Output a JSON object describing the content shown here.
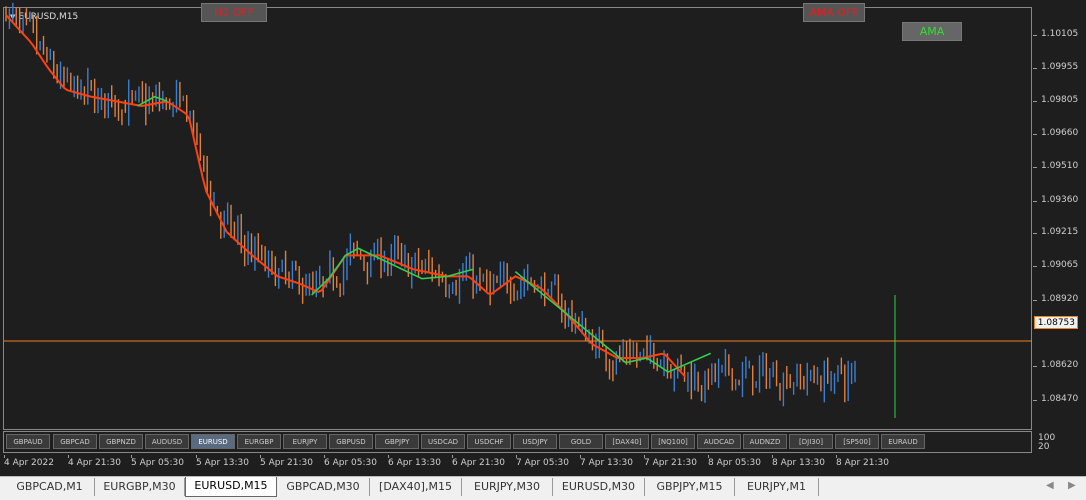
{
  "window": {
    "title": "EURUSD,M15"
  },
  "buttons": {
    "h1_off": "H1 OFF",
    "ama_off": "AMA OFF",
    "ama": "AMA"
  },
  "colors": {
    "bull": "#3a7fd0",
    "bear": "#e08040",
    "ma_red": "#ff4010",
    "ama_green": "#30d050",
    "price_line": "#f08020"
  },
  "price_axis": {
    "labels": [
      "1.10105",
      "1.09955",
      "1.09805",
      "1.09660",
      "1.09510",
      "1.09360",
      "1.09215",
      "1.09065",
      "1.08920",
      "1.08620",
      "1.08470"
    ],
    "last_price": "1.08753"
  },
  "subpanel": {
    "symbols": [
      "GBPAUD",
      "GBPCAD",
      "GBPNZD",
      "AUDUSD",
      "EURUSD",
      "EURGBP",
      "EURJPY",
      "GBPUSD",
      "GBPJPY",
      "USDCAD",
      "USDCHF",
      "USDJPY",
      "GOLD",
      "[DAX40]",
      "[NQ100]",
      "AUDCAD",
      "AUDNZD",
      "[DJI30]",
      "[SP500]",
      "EURAUD"
    ],
    "active": "EURUSD",
    "axis_top": "100",
    "axis_bottom": "20"
  },
  "time_axis": {
    "labels": [
      "4 Apr 2022",
      "4 Apr 21:30",
      "5 Apr 05:30",
      "5 Apr 13:30",
      "5 Apr 21:30",
      "6 Apr 05:30",
      "6 Apr 13:30",
      "6 Apr 21:30",
      "7 Apr 05:30",
      "7 Apr 13:30",
      "7 Apr 21:30",
      "8 Apr 05:30",
      "8 Apr 13:30",
      "8 Apr 21:30"
    ]
  },
  "tabs": [
    "GBPCAD,M1",
    "EURGBP,M30",
    "EURUSD,M15",
    "GBPCAD,M30",
    "[DAX40],M15",
    "EURJPY,M30",
    "EURUSD,M30",
    "GBPJPY,M15",
    "EURJPY,M1"
  ],
  "active_tab": "EURUSD,M15",
  "chart_data": {
    "type": "candlestick",
    "symbol": "EURUSD",
    "timeframe": "M15",
    "ylim": [
      1.0838,
      1.1018
    ],
    "ma_red": [
      [
        0,
        1.1015
      ],
      [
        0.03,
        1.1003
      ],
      [
        0.05,
        1.0992
      ],
      [
        0.07,
        1.0983
      ],
      [
        0.1,
        1.098
      ],
      [
        0.13,
        1.0978
      ],
      [
        0.16,
        1.0976
      ],
      [
        0.19,
        1.0978
      ],
      [
        0.215,
        1.0972
      ],
      [
        0.235,
        1.094
      ],
      [
        0.26,
        1.0922
      ],
      [
        0.29,
        1.0912
      ],
      [
        0.32,
        1.0903
      ],
      [
        0.345,
        1.09
      ],
      [
        0.37,
        1.0896
      ],
      [
        0.4,
        1.0912
      ],
      [
        0.44,
        1.0912
      ],
      [
        0.48,
        1.0906
      ],
      [
        0.52,
        1.0903
      ],
      [
        0.545,
        1.0903
      ],
      [
        0.57,
        1.0895
      ],
      [
        0.6,
        1.0903
      ],
      [
        0.63,
        1.0898
      ],
      [
        0.66,
        1.0887
      ],
      [
        0.69,
        1.0874
      ],
      [
        0.72,
        1.0868
      ],
      [
        0.75,
        1.0868
      ],
      [
        0.775,
        1.087
      ],
      [
        0.8,
        1.086
      ]
    ],
    "ama_green": [
      [
        0.155,
        1.0976
      ],
      [
        0.175,
        1.098
      ],
      [
        0.19,
        1.0978
      ],
      [
        0.36,
        1.0895
      ],
      [
        0.38,
        1.0902
      ],
      [
        0.4,
        1.0912
      ],
      [
        0.415,
        1.0915
      ],
      [
        0.49,
        1.0902
      ],
      [
        0.52,
        1.0903
      ],
      [
        0.55,
        1.0906
      ],
      [
        0.58,
        1.0898
      ],
      [
        0.6,
        1.0905
      ],
      [
        0.73,
        1.0866
      ],
      [
        0.755,
        1.0868
      ],
      [
        0.78,
        1.0862
      ],
      [
        0.805,
        1.0866
      ],
      [
        0.83,
        1.087
      ]
    ],
    "current_price": 1.08753,
    "candle_count": 250
  }
}
